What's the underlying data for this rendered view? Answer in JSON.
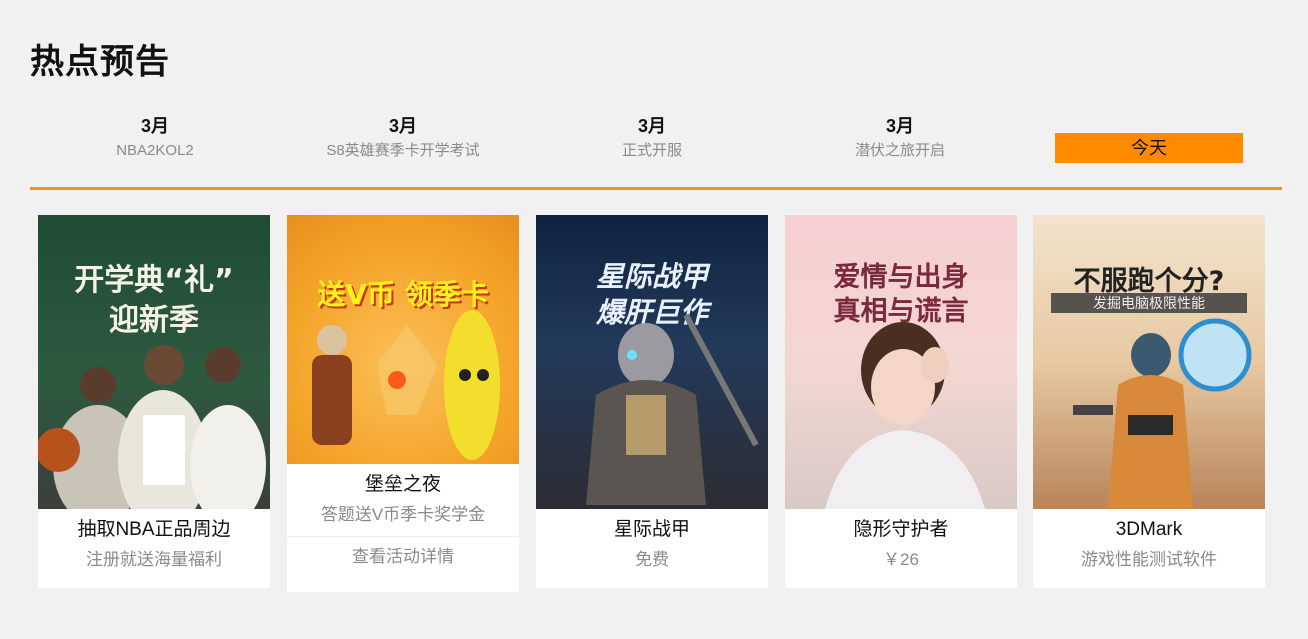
{
  "section": {
    "title": "热点预告"
  },
  "timeline": {
    "items": [
      {
        "month": "3月",
        "event": "NBA2KOL2"
      },
      {
        "month": "3月",
        "event": "S8英雄赛季卡开学考试"
      },
      {
        "month": "3月",
        "event": "正式开服"
      },
      {
        "month": "3月",
        "event": "潜伏之旅开启"
      }
    ],
    "today_label": "今天"
  },
  "cards": [
    {
      "art_lines": [
        "开学典“礼”",
        "迎新季"
      ],
      "title": "抽取NBA正品周边",
      "sub": "注册就送海量福利"
    },
    {
      "art_lines": [
        "送V币 领季卡"
      ],
      "title": "堡垒之夜",
      "sub": "答题送V币季卡奖学金",
      "link": "查看活动详情"
    },
    {
      "art_lines": [
        "星际战甲",
        "爆肝巨作"
      ],
      "title": "星际战甲",
      "sub": "免费"
    },
    {
      "art_lines": [
        "爱情与出身",
        "真相与谎言"
      ],
      "title": "隐形守护者",
      "sub": "￥26"
    },
    {
      "art_lines": [
        "不服跑个分?"
      ],
      "art_banner": "发掘电脑极限性能",
      "title": "3DMark",
      "sub": "游戏性能测试软件"
    }
  ],
  "colors": {
    "accent": "#f0931e",
    "today_bg": "#ff8a00",
    "background": "#f1f1f1"
  }
}
